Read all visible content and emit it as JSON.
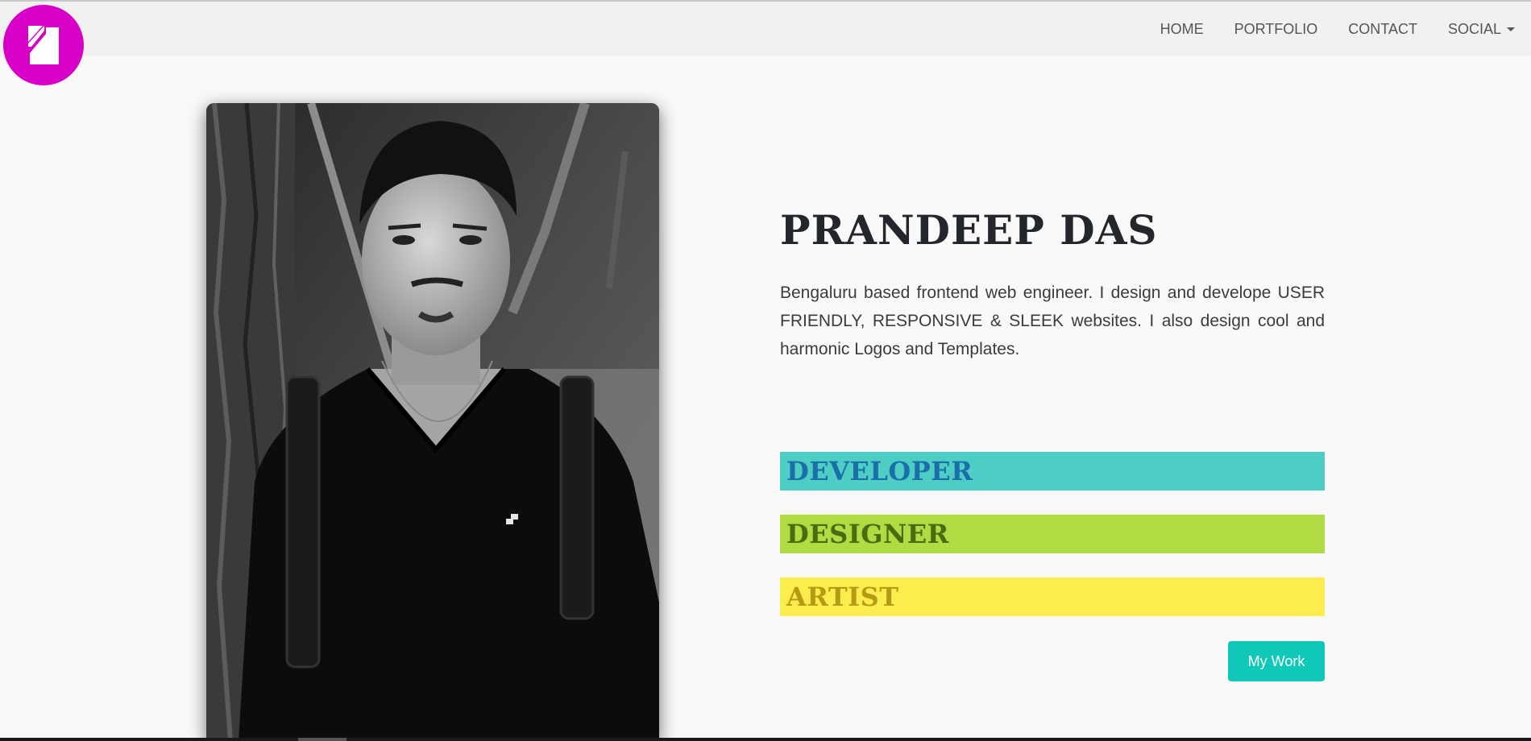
{
  "brand": {
    "logo_icon": "logo-mark-icon",
    "logo_color": "#d600c6"
  },
  "nav": {
    "items": [
      {
        "label": "HOME"
      },
      {
        "label": "PORTFOLIO"
      },
      {
        "label": "CONTACT"
      },
      {
        "label": "SOCIAL"
      }
    ],
    "social_dropdown_icon": "caret-down-icon"
  },
  "hero": {
    "name": "PRANDEEP DAS",
    "bio": "Bengaluru based frontend web engineer. I design and develope USER FRIENDLY, RESPONSIVE & SLEEK websites. I also design cool and harmonic Logos and Templates.",
    "photo_description": "black-and-white portrait photo",
    "roles": [
      {
        "label": "DEVELOPER",
        "bg": "#4ecdc4",
        "color": "#1a6fa8"
      },
      {
        "label": "DESIGNER",
        "bg": "#b0dc43",
        "color": "#4d6a10"
      },
      {
        "label": "ARTIST",
        "bg": "#fced4f",
        "color": "#b59a13"
      }
    ],
    "cta_label": "My Work",
    "cta_color": "#0fc8b8"
  }
}
